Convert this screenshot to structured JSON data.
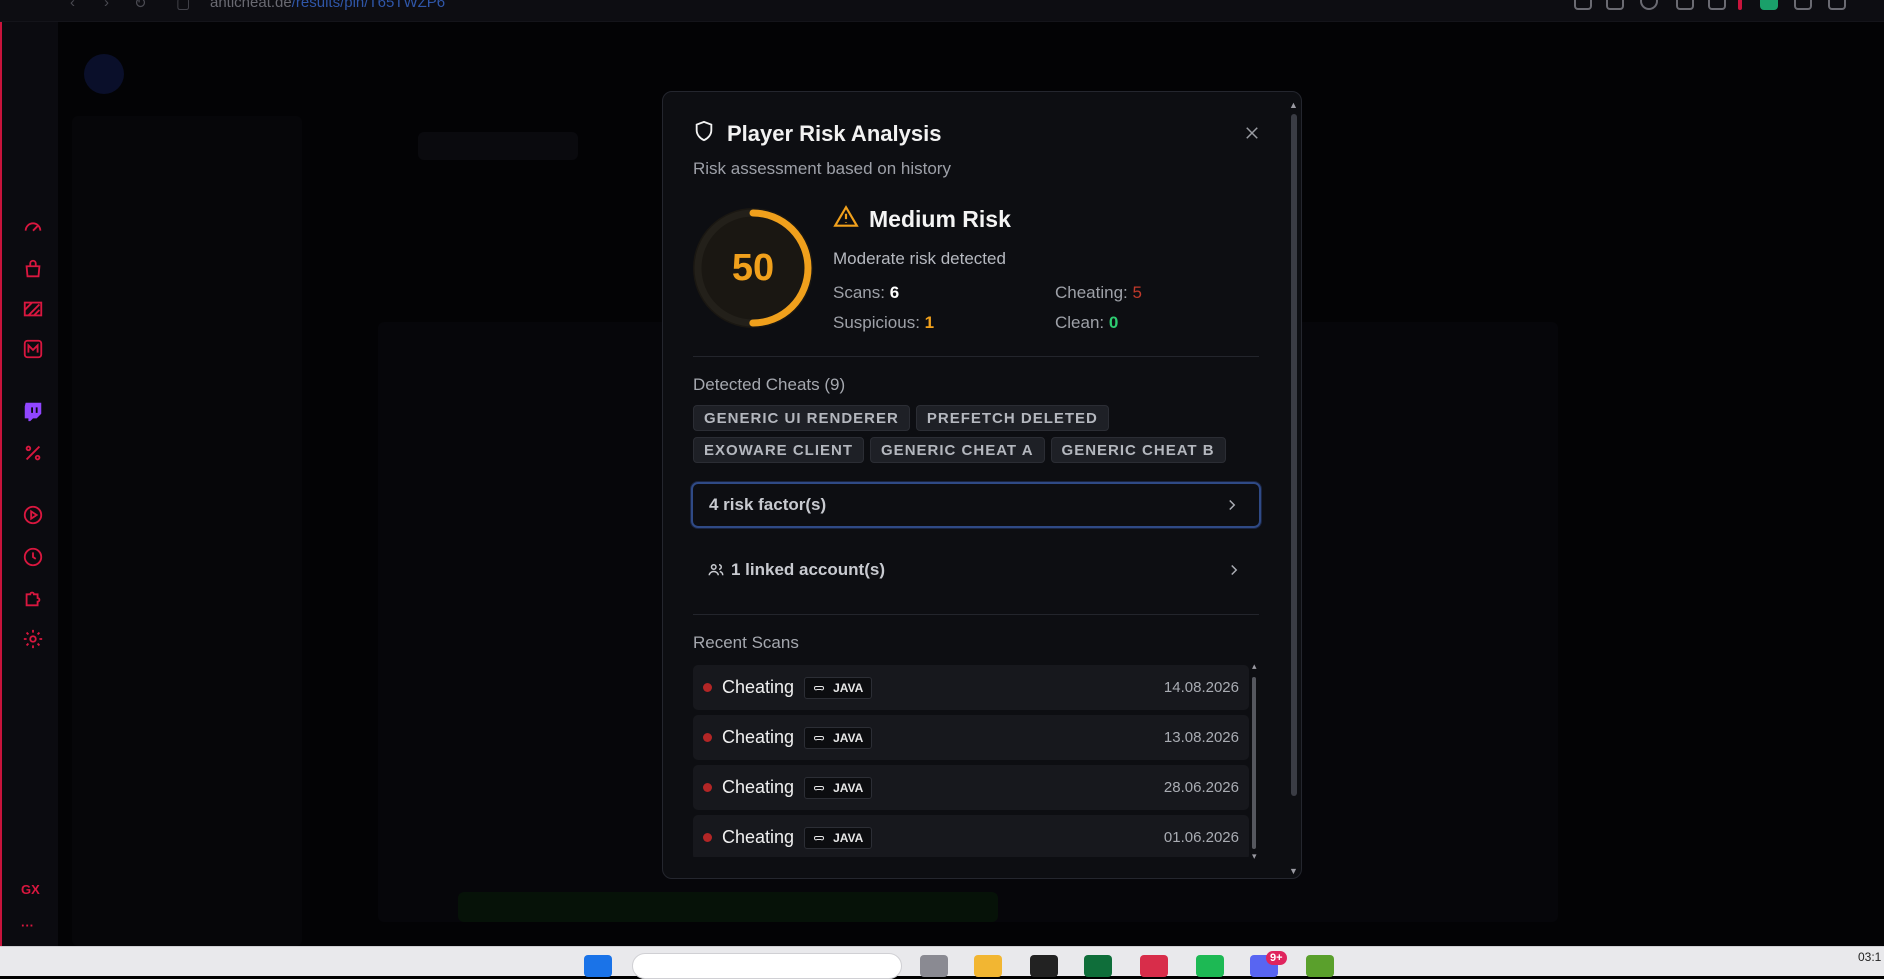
{
  "browser": {
    "url_host": "anticheat.de",
    "url_path": "/results/pin/T65TWZP6"
  },
  "modal": {
    "title": "Player Risk Analysis",
    "subtitle": "Risk assessment based on history",
    "score": "50",
    "score_fraction": 0.5,
    "risk_level": "Medium Risk",
    "risk_description": "Moderate risk detected",
    "stats": {
      "scans_label": "Scans:",
      "scans_value": "6",
      "cheating_label": "Cheating:",
      "cheating_value": "5",
      "suspicious_label": "Suspicious:",
      "suspicious_value": "1",
      "clean_label": "Clean:",
      "clean_value": "0"
    },
    "detected_title": "Detected Cheats (9)",
    "tags": [
      "GENERIC UI RENDERER",
      "PREFETCH DELETED",
      "EXOWARE CLIENT",
      "GENERIC CHEAT A",
      "GENERIC CHEAT B"
    ],
    "risk_factors_label": "4 risk factor(s)",
    "linked_accounts_label": "1 linked account(s)",
    "recent_title": "Recent Scans",
    "scans": [
      {
        "status": "Cheating",
        "platform": "JAVA",
        "date": "14.08.2026"
      },
      {
        "status": "Cheating",
        "platform": "JAVA",
        "date": "13.08.2026"
      },
      {
        "status": "Cheating",
        "platform": "JAVA",
        "date": "28.06.2026"
      },
      {
        "status": "Cheating",
        "platform": "JAVA",
        "date": "01.06.2026"
      }
    ]
  },
  "colors": {
    "score": "#f0a01c",
    "warning": "#f0a01c",
    "cheating": "#c0392b",
    "suspicious": "#f0a01c",
    "clean": "#2ecc71",
    "gx_accent": "#d9173f"
  },
  "sidebar_icons": [
    "speedometer-icon",
    "bag-icon",
    "stripes-icon",
    "messenger-m-icon",
    "twitch-icon",
    "percent-icon",
    "play-icon",
    "clock-icon",
    "puzzle-icon",
    "settings-icon"
  ],
  "sidebar_gx_label": "GX",
  "sidebar_more_label": "···",
  "taskbar": {
    "notification_badge": "9+",
    "clock": "03:1"
  }
}
